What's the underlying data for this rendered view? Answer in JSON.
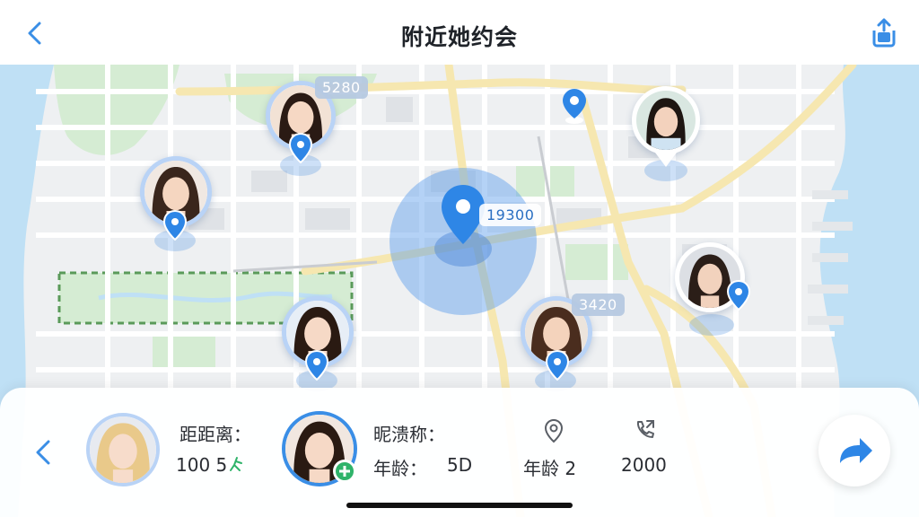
{
  "header": {
    "title": "附近她约会",
    "back_icon": "chevron-left-icon",
    "share_icon": "share-upload-icon"
  },
  "map": {
    "colors": {
      "water": "#bfe0f5",
      "land": "#eef0f2",
      "park": "#d5ecd3",
      "road": "#ffffff",
      "major_road": "#f6e7b0",
      "accent": "#3a8ee6"
    },
    "center_label": "19300",
    "users": [
      {
        "id": "user-1",
        "distance_label": "5280"
      },
      {
        "id": "user-2",
        "distance_label": ""
      },
      {
        "id": "user-3",
        "distance_label": ""
      },
      {
        "id": "user-4",
        "distance_label": ""
      },
      {
        "id": "user-5",
        "distance_label": "3420"
      },
      {
        "id": "user-6",
        "distance_label": ""
      }
    ]
  },
  "panel": {
    "distance_label": "距距离：",
    "distance_value": "100 5",
    "nickname_label": "昵溃称：",
    "age_label": "年龄：",
    "age_value": "5D",
    "location_age_label": "年龄 2",
    "count_value": "2000",
    "icons": {
      "prev": "chevron-left-icon",
      "location": "location-pin-icon",
      "call": "phone-call-icon",
      "next": "forward-arrow-icon",
      "add": "add-friend-icon",
      "walk": "walk-icon"
    }
  }
}
